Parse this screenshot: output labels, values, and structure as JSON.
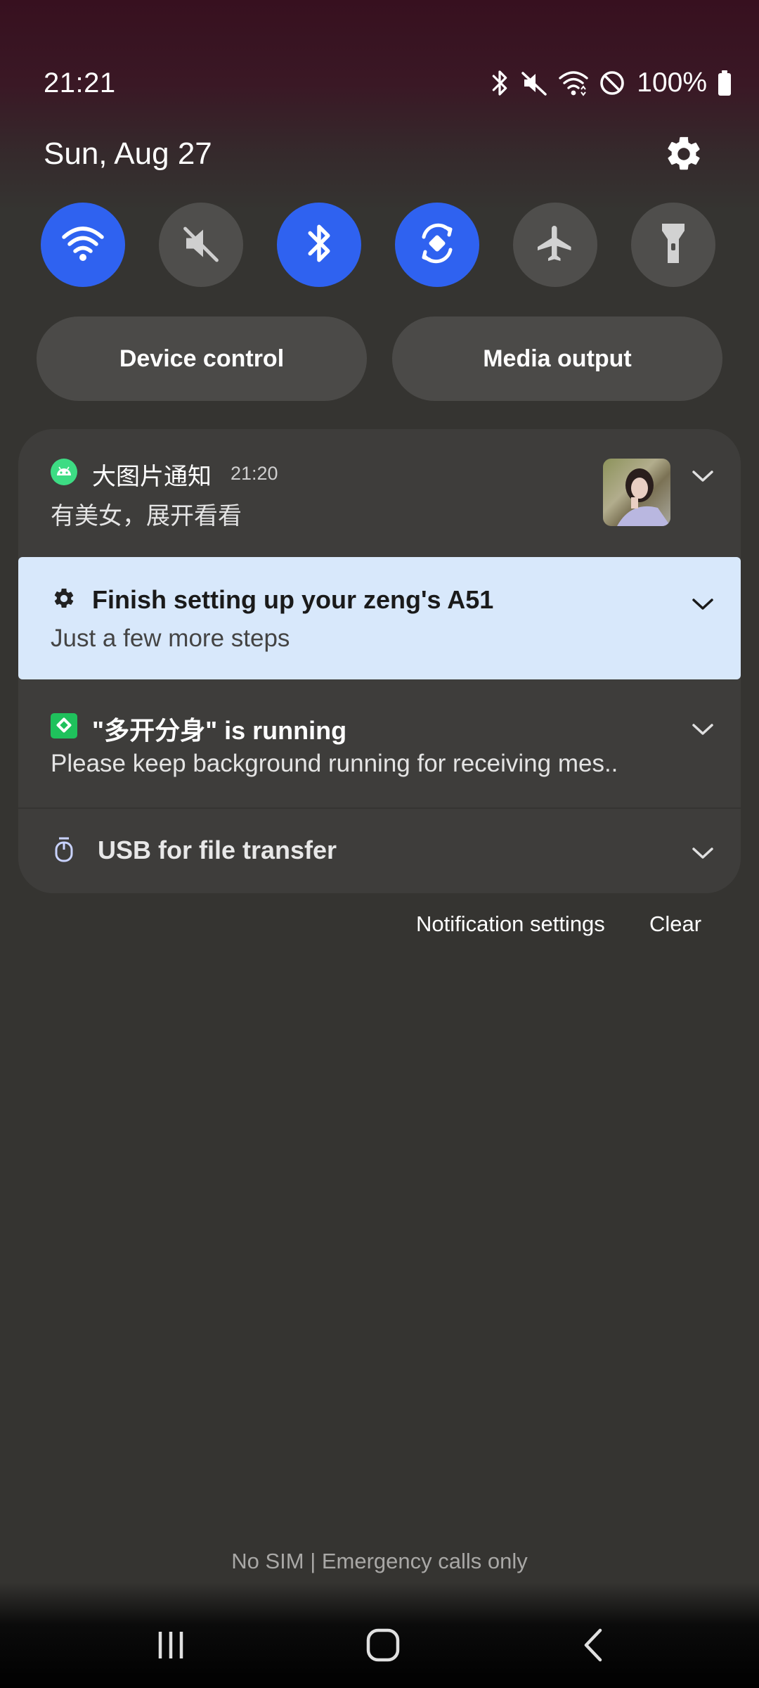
{
  "status_bar": {
    "time": "21:21",
    "battery": "100%",
    "icons": [
      "bluetooth-icon",
      "mute-icon",
      "wifi-icon",
      "do-not-disturb-icon",
      "battery-icon"
    ]
  },
  "header": {
    "date": "Sun, Aug 27",
    "settings_icon": "gear-icon"
  },
  "quick_toggles": [
    {
      "name": "wifi",
      "icon": "wifi-icon",
      "state": "on"
    },
    {
      "name": "sound",
      "icon": "mute-icon",
      "state": "off"
    },
    {
      "name": "bluetooth",
      "icon": "bluetooth-icon",
      "state": "on"
    },
    {
      "name": "auto-rotate",
      "icon": "rotate-icon",
      "state": "on"
    },
    {
      "name": "airplane-mode",
      "icon": "airplane-icon",
      "state": "off"
    },
    {
      "name": "flashlight",
      "icon": "flashlight-icon",
      "state": "off"
    }
  ],
  "buttons": {
    "device_control": "Device control",
    "media_output": "Media output"
  },
  "notifications": [
    {
      "app": "大图片通知",
      "time": "21:20",
      "text": "有美女，展开看看",
      "icon": "android-icon"
    },
    {
      "title": "Finish setting up your zeng's A51",
      "text": "Just a few more steps",
      "icon": "gear-icon"
    },
    {
      "title": "\"多开分身\" is running",
      "text": "Please keep background running for receiving mes..",
      "icon": "app-icon"
    },
    {
      "title": "USB for file transfer",
      "icon": "usb-icon"
    }
  ],
  "panel_actions": {
    "notification_settings": "Notification settings",
    "clear": "Clear"
  },
  "carrier_text": "No SIM | Emergency calls only",
  "nav_bar": {
    "icons": [
      "recents-icon",
      "home-icon",
      "back-icon"
    ]
  },
  "colors": {
    "accent": "#2f62f0",
    "toggle_off": "#4f4e4c",
    "highlight_notification": "#d8e8fb",
    "background": "#353431"
  }
}
